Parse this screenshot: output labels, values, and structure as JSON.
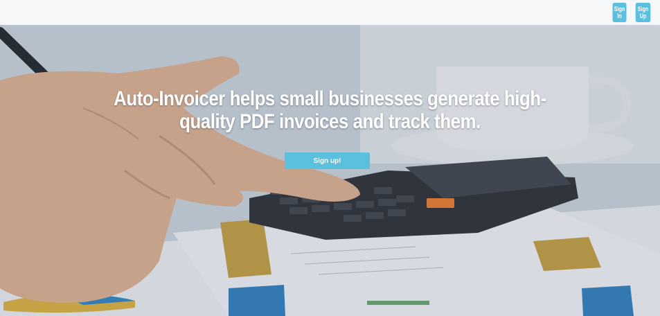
{
  "header": {
    "sign_in_label": "Sign In",
    "sign_up_label": "Sign Up"
  },
  "hero": {
    "title": "Auto-Invoicer helps small businesses generate high-quality PDF invoices and track them.",
    "cta_label": "Sign up!"
  },
  "colors": {
    "accent": "#5bc0de",
    "header_bg": "#f6f7f9",
    "text_on_image": "#ffffff"
  }
}
